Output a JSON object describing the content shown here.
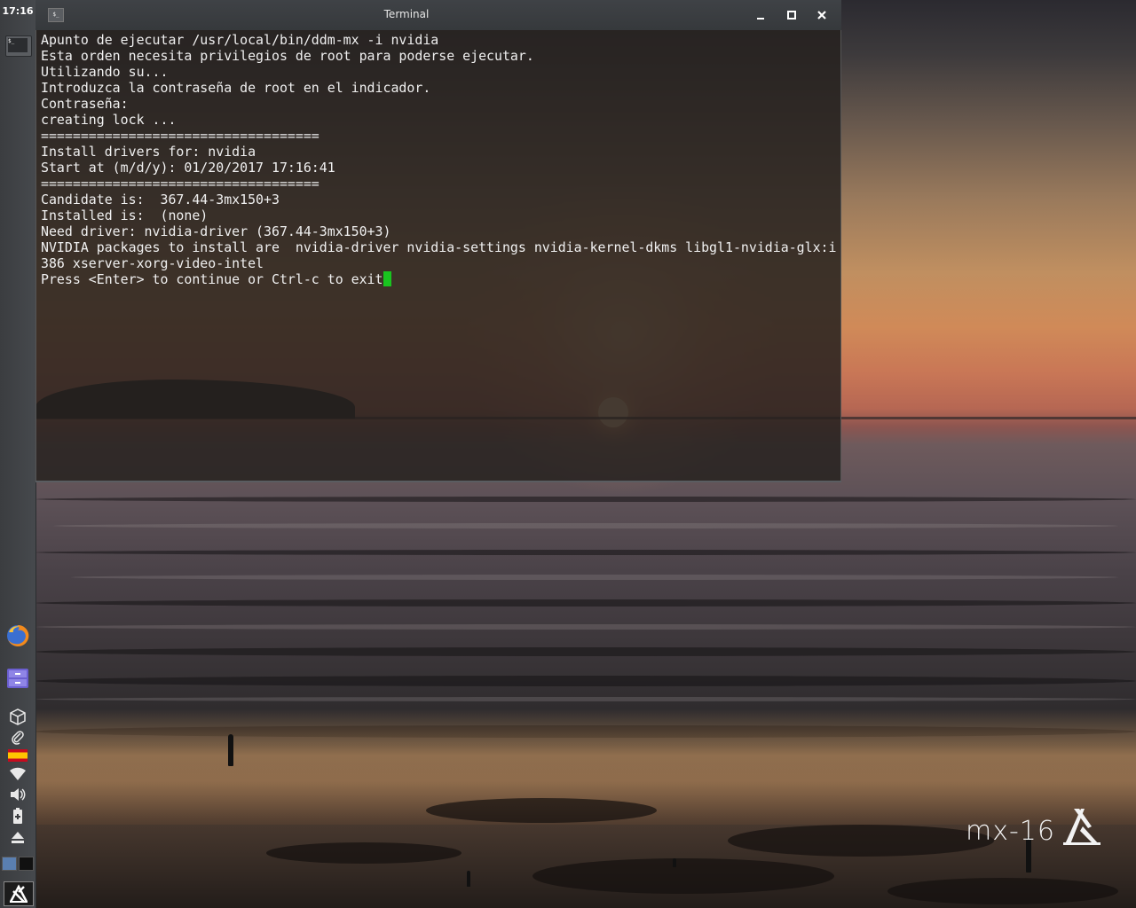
{
  "panel": {
    "clock": "17:16",
    "task_icon_text": "$_",
    "launchers": [
      "firefox-icon",
      "file-manager-icon"
    ],
    "tray": [
      "package-box-icon",
      "paperclip-icon",
      "spain-flag-icon",
      "wifi-icon",
      "volume-icon",
      "battery-icon",
      "eject-icon"
    ],
    "pager_active": 1
  },
  "window": {
    "title": "Terminal",
    "icon_text": "$_"
  },
  "terminal": {
    "lines": [
      "Apunto de ejecutar /usr/local/bin/ddm-mx -i nvidia",
      "Esta orden necesita privilegios de root para poderse ejecutar.",
      "Utilizando su...",
      "Introduzca la contraseña de root en el indicador.",
      "Contraseña:",
      "creating lock ...",
      "===================================",
      "Install drivers for: nvidia",
      "Start at (m/d/y): 01/20/2017 17:16:41",
      "===================================",
      "Candidate is:  367.44-3mx150+3",
      "Installed is:  (none)",
      "Need driver: nvidia-driver (367.44-3mx150+3)",
      "NVIDIA packages to install are  nvidia-driver nvidia-settings nvidia-kernel-dkms libgl1-nvidia-glx:i",
      "386 xserver-xorg-video-intel"
    ],
    "prompt": "Press <Enter> to continue or Ctrl-c to exit"
  },
  "desktop": {
    "logo_text": "mx-16"
  },
  "colors": {
    "cursor": "#19c41f",
    "panel": "#3b3d40",
    "terminal_text": "#f0f0f0"
  }
}
